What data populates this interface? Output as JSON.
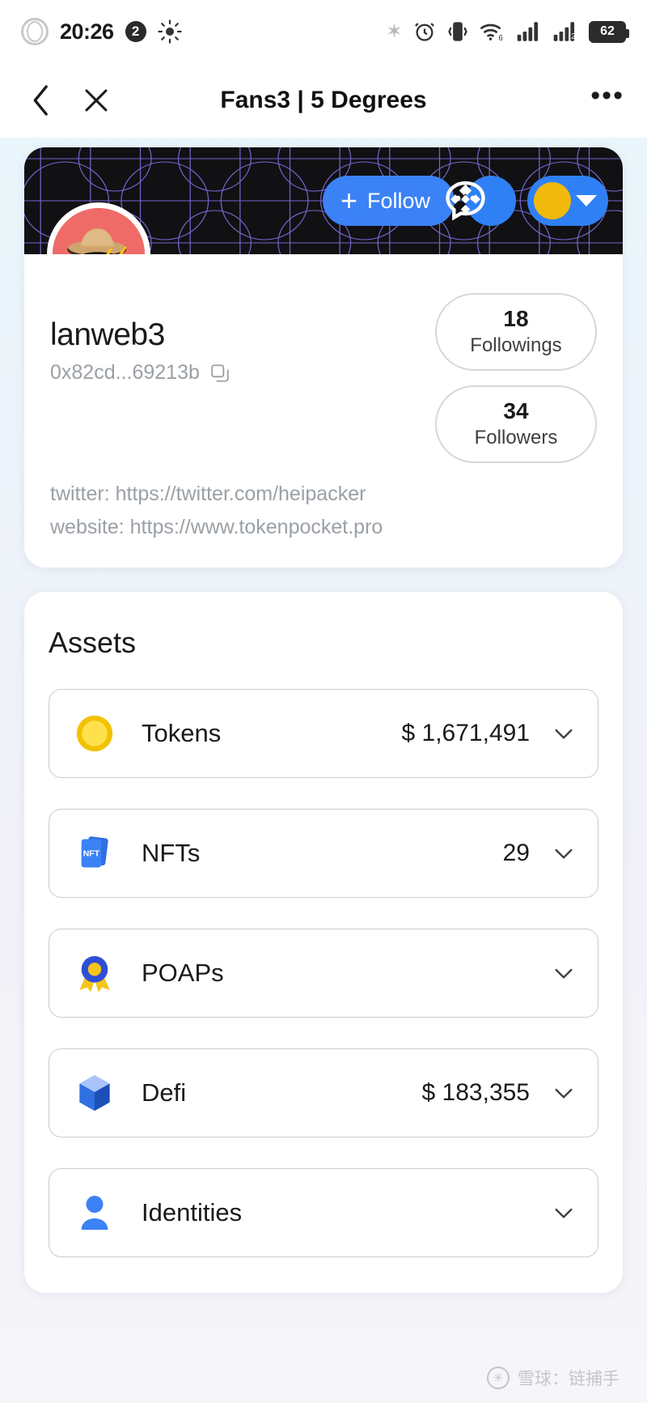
{
  "status_bar": {
    "time": "20:26",
    "notification_count": "2",
    "battery_level": "62",
    "wifi_generation": "6",
    "sim2_label": "2",
    "icons": [
      "recorder-ring-icon",
      "brightness-icon",
      "bluetooth-icon",
      "alarm-icon",
      "vibrate-icon",
      "wifi-icon",
      "signal-1-icon",
      "signal-2-icon",
      "battery-icon"
    ]
  },
  "navbar": {
    "title": "Fans3 | 5 Degrees",
    "back_icon": "chevron-left-icon",
    "close_icon": "close-icon",
    "more_icon": "more-horizontal-icon"
  },
  "profile": {
    "username": "lanweb3",
    "address": "0x82cd...69213b",
    "copy_icon": "copy-icon",
    "follow_label": "Follow",
    "chat_icon": "chat-bubble-icon",
    "chain_icon": "binance-bnb-icon",
    "chain_caret_icon": "caret-down-icon",
    "avatar_icon": "user-avatar",
    "stats": [
      {
        "value": "18",
        "label": "Followings"
      },
      {
        "value": "34",
        "label": "Followers"
      }
    ],
    "links": [
      "twitter: https://twitter.com/heipacker",
      "website: https://www.tokenpocket.pro"
    ]
  },
  "assets": {
    "title": "Assets",
    "rows": [
      {
        "icon": "coin-icon",
        "label": "Tokens",
        "value": "$ 1,671,491",
        "chevron": "chevron-down-icon"
      },
      {
        "icon": "nft-cards-icon",
        "label": "NFTs",
        "value": "29",
        "chevron": "chevron-down-icon"
      },
      {
        "icon": "poap-badge-icon",
        "label": "POAPs",
        "value": "",
        "chevron": "chevron-down-icon"
      },
      {
        "icon": "defi-cube-icon",
        "label": "Defi",
        "value": "$ 183,355",
        "chevron": "chevron-down-icon"
      },
      {
        "icon": "identity-person-icon",
        "label": "Identities",
        "value": "",
        "chevron": "chevron-down-icon"
      }
    ]
  },
  "footer": {
    "watermark": "雪球：链捕手",
    "logo_icon": "xueqiu-logo-icon"
  },
  "colors": {
    "accent_blue": "#3b82f6",
    "banner_dark": "#111013",
    "banner_grid": "#7b6bd6",
    "binance_yellow": "#f0b90b",
    "muted_text": "#9aa0a6"
  }
}
